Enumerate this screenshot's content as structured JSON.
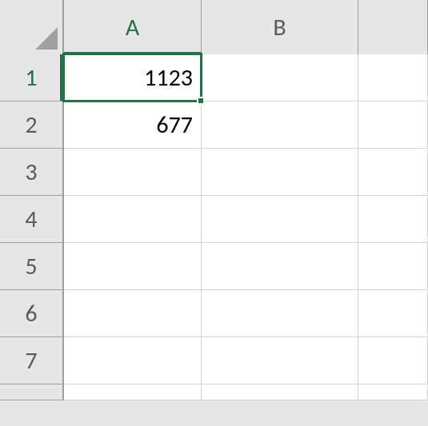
{
  "columns": [
    "A",
    "B"
  ],
  "rows": [
    "1",
    "2",
    "3",
    "4",
    "5",
    "6",
    "7"
  ],
  "cells": {
    "A1": "1123",
    "A2": "677"
  },
  "active_cell": "A1",
  "colors": {
    "selection": "#217346"
  }
}
